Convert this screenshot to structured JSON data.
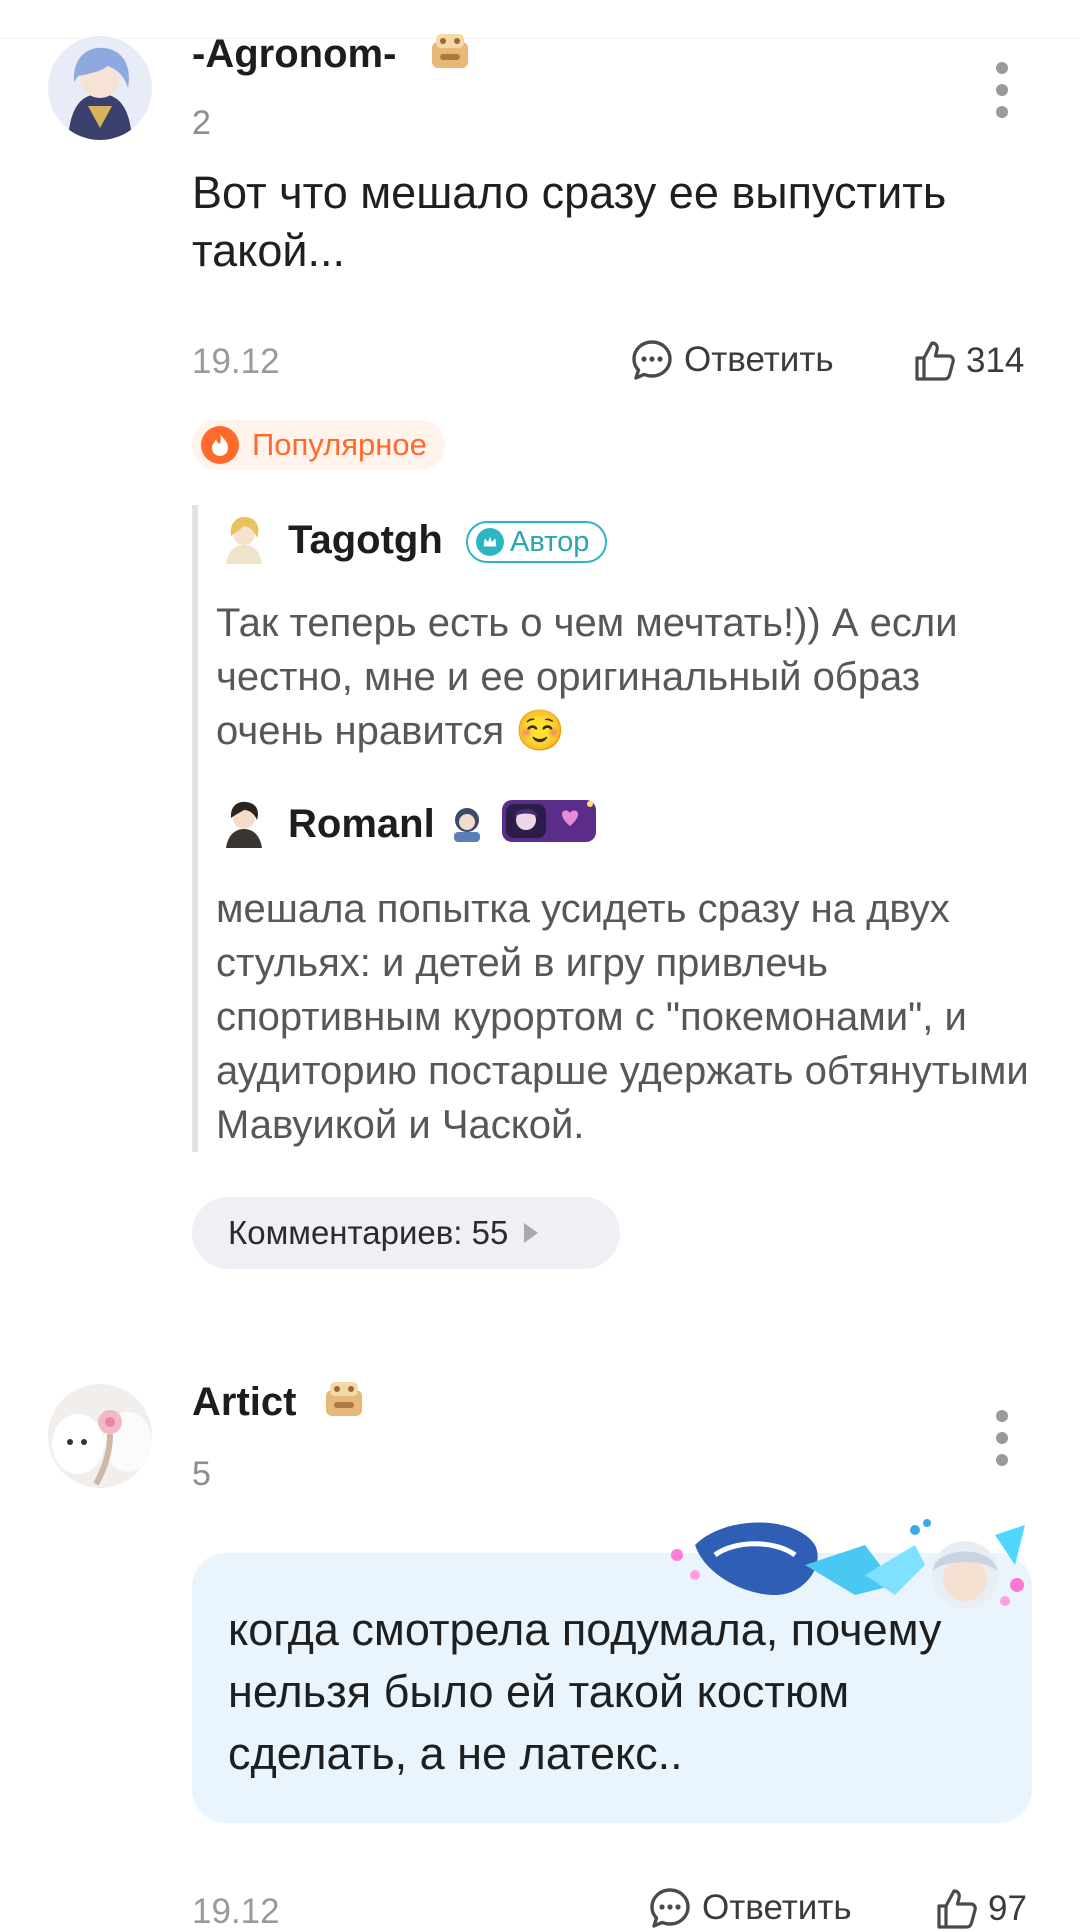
{
  "comments": [
    {
      "author": "-Agronom-",
      "level": "2",
      "text": "Вот что мешало сразу ее выпустить такой...",
      "date": "19.12",
      "reply_label": "Ответить",
      "likes": "314",
      "popular_label": "Популярное",
      "replies": [
        {
          "author": "Tagotgh",
          "badge": "Автор",
          "text": "Так теперь есть о чем мечтать!)) А если честно, мне и ее оригинальный образ очень нравится ☺️"
        },
        {
          "author": "Romanl",
          "text": "мешала попытка усидеть сразу на двух стульях: и детей в игру привлечь спортивным курортом с \"покемонами\", и аудиторию постарше удержать обтянутыми Мавуикой и Чаской."
        }
      ],
      "comments_count_label": "Комментариев: 55"
    },
    {
      "author": "Artict",
      "level": "5",
      "text": "когда смотрела подумала, почему нельзя было ей такой костюм сделать, а не латекс..",
      "date": "19.12",
      "reply_label": "Ответить",
      "likes": "97"
    }
  ],
  "colors": {
    "popular": "#ff6a2c",
    "author_badge": "#2db6c2",
    "bubble_bg": "#e9f4fc",
    "pill_bg": "#eef0f6"
  }
}
